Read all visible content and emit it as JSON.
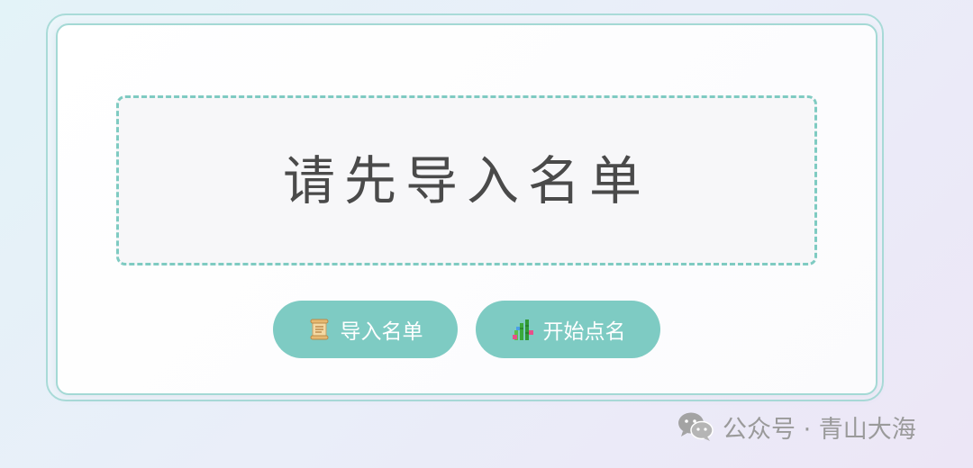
{
  "display": {
    "text": "请先导入名单"
  },
  "buttons": {
    "import": {
      "label": "导入名单",
      "icon": "scroll-icon"
    },
    "start": {
      "label": "开始点名",
      "icon": "bamboo-icon"
    }
  },
  "watermark": {
    "text": "公众号 · 青山大海",
    "icon": "wechat-icon"
  },
  "colors": {
    "accent": "#7ecbc3",
    "dashed_border": "#7fcbc2",
    "frame_border": "#a4d9d5",
    "display_text": "#4a4a4a",
    "watermark_text": "#9a9a9a"
  }
}
